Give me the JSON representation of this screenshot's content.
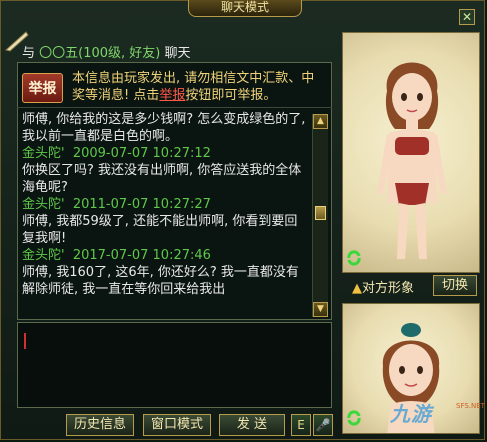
{
  "window": {
    "title": "聊天模式",
    "close_label": "✕"
  },
  "header": {
    "prefix": "与",
    "partner_name": "〇〇五(100级, 好友)",
    "suffix": "聊天"
  },
  "report": {
    "button_label": "举报",
    "notice_before": "本信息由玩家发出, 请勿相信文中汇款、中奖等消息! 点击",
    "notice_link": "举报",
    "notice_after": "按钮即可举报。"
  },
  "messages": [
    {
      "type": "text",
      "text": "师傅, 你给我的这是多少钱啊? 怎么变成绿色的了, 我以前一直都是白色的啊。"
    },
    {
      "type": "meta",
      "sender": "金头陀'",
      "time": "2009-07-07 10:27:12"
    },
    {
      "type": "text",
      "text": "你换区了吗? 我还没有出师啊, 你答应送我的全体海龟呢?"
    },
    {
      "type": "meta",
      "sender": "金头陀'",
      "time": "2011-07-07 10:27:27"
    },
    {
      "type": "text",
      "text": "师傅, 我都59级了, 还能不能出师啊, 你看到要回复我啊!"
    },
    {
      "type": "meta",
      "sender": "金头陀'",
      "time": "2017-07-07 10:27:46"
    },
    {
      "type": "text",
      "text": "师傅, 我160了, 这6年, 你还好么? 我一直都没有解除师徒, 我一直在等你回来给我出"
    }
  ],
  "toolbar": {
    "history_label": "历史信息",
    "window_mode_label": "窗口模式",
    "send_label": "发 送",
    "emote_label": "E",
    "voice_label": "🎤"
  },
  "sidebar": {
    "opponent_label": "对方形象",
    "switch_label": "切换"
  },
  "watermark": {
    "text": "九游",
    "sub": "SFS.NET"
  },
  "colors": {
    "accent": "#b59b4a",
    "meta": "#5fc84a",
    "notice": "#f0d27a",
    "link": "#ff5a4a"
  }
}
